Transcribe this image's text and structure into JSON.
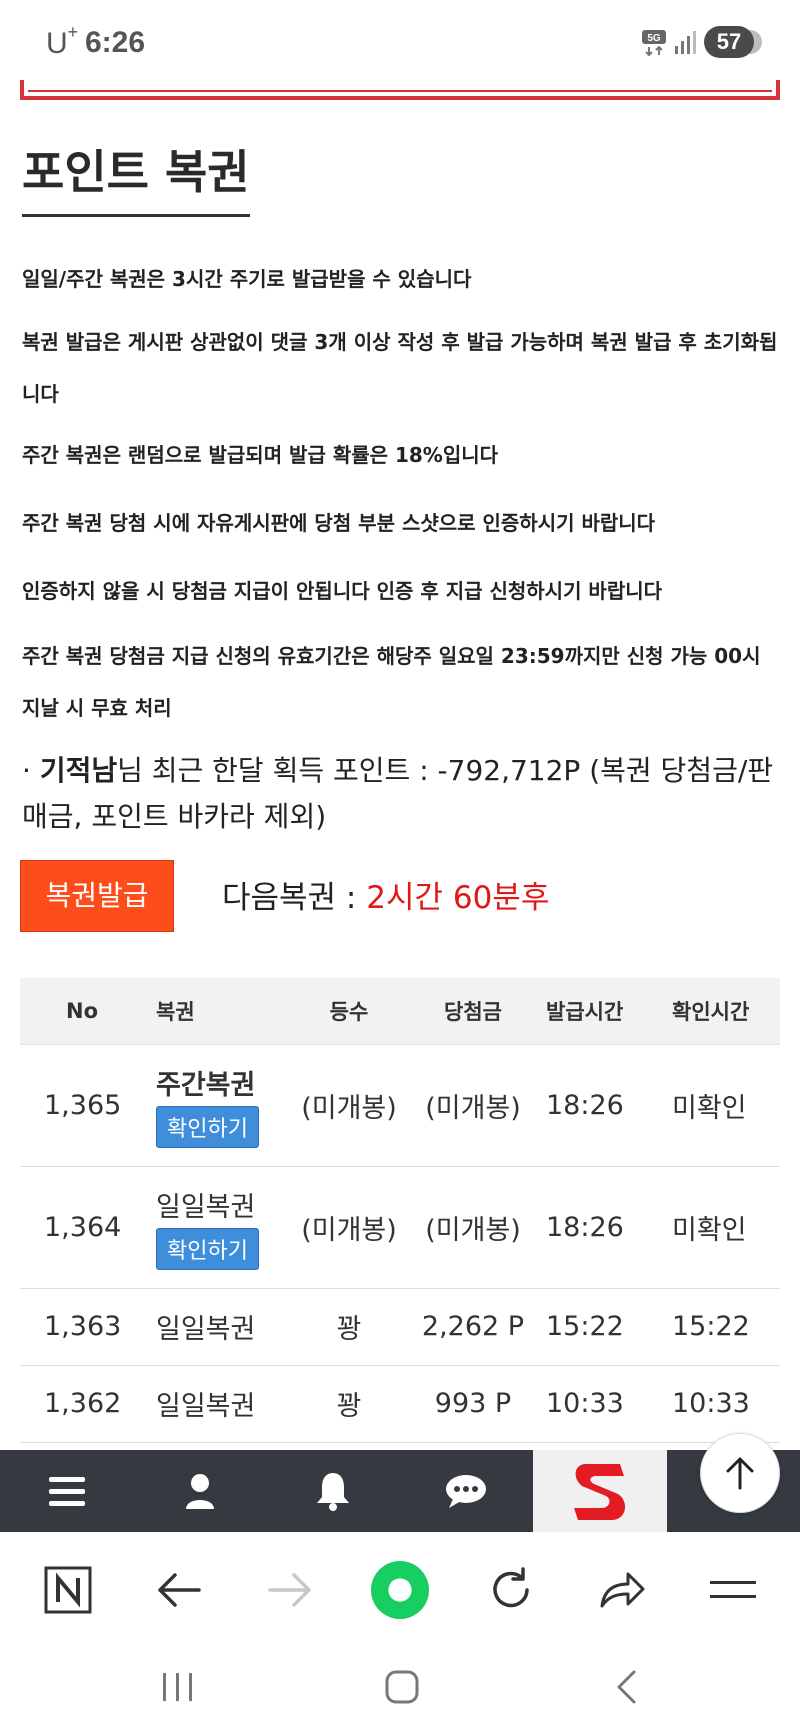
{
  "status_bar": {
    "carrier": "U",
    "carrier_sup": "+",
    "time": "6:26",
    "battery": "57"
  },
  "page": {
    "title": "포인트 복권",
    "rules": [
      "일일/주간 복권은 3시간 주기로 발급받을 수 있습니다",
      "복권 발급은 게시판 상관없이 댓글 3개 이상 작성 후 발급 가능하며 복권 발급 후 초기화됩니다",
      "주간 복권은 랜덤으로 발급되며 발급 확률은 18%입니다",
      "주간 복권 당첨 시에 자유게시판에 당첨 부분 스샷으로 인증하시기 바랍니다",
      "인증하지 않을 시 당첨금 지급이 안됩니다 인증 후 지급 신청하시기 바랍니다",
      "주간 복권 당첨금 지급 신청의 유효기간은 해당주 일요일 23:59까지만 신청 가능 00시 지날 시 무효 처리"
    ],
    "points_prefix": "· ",
    "username": "기적남",
    "points_text": "님 최근 한달 획득 포인트 : -792,712P (복권 당첨금/판매금, 포인트 바카라 제외)",
    "issue_button": "복권발급",
    "next_label": "다음복권 : ",
    "next_value": "2시간 60분후"
  },
  "table": {
    "headers": [
      "No",
      "복권",
      "등수",
      "당첨금",
      "발급시간",
      "확인시간"
    ],
    "confirm_label": "확인하기",
    "rows": [
      {
        "no": "1,365",
        "name": "주간복권",
        "rank": "(미개봉)",
        "prize": "(미개봉)",
        "issued": "18:26",
        "checked": "미확인"
      },
      {
        "no": "1,364",
        "name": "일일복권",
        "rank": "(미개봉)",
        "prize": "(미개봉)",
        "issued": "18:26",
        "checked": "미확인"
      },
      {
        "no": "1,363",
        "name": "일일복권",
        "rank": "꽝",
        "prize": "2,262 P",
        "issued": "15:22",
        "checked": "15:22"
      },
      {
        "no": "1,362",
        "name": "일일복권",
        "rank": "꽝",
        "prize": "993 P",
        "issued": "10:33",
        "checked": "10:33"
      }
    ]
  },
  "site_nav": {
    "icons": [
      "menu-icon",
      "user-icon",
      "bell-icon",
      "chat-icon",
      "site-logo",
      "scroll-top-icon"
    ]
  },
  "browser_bar": {
    "icons": [
      "naver-icon",
      "back-arrow-icon",
      "forward-arrow-icon",
      "green-dot-icon",
      "refresh-icon",
      "share-icon",
      "menu-lines-icon"
    ]
  },
  "colors": {
    "accent_orange": "#fc4d1b",
    "next_red": "#e01818",
    "unchecked_amber": "#f2a20f",
    "confirm_blue": "#3e8edc",
    "nav_dark": "#343a40"
  }
}
